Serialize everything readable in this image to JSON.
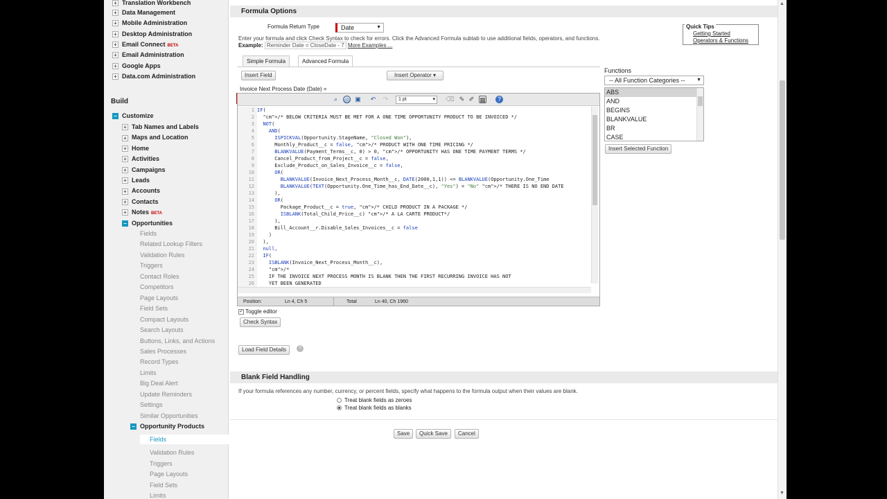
{
  "sidebar": {
    "admin_items": [
      "Translation Workbench",
      "Data Management",
      "Mobile Administration",
      "Desktop Administration",
      "Email Connect",
      "Email Administration",
      "Google Apps",
      "Data.com Administration"
    ],
    "beta_label": "BETA",
    "build_heading": "Build",
    "customize": "Customize",
    "customize_items": [
      "Tab Names and Labels",
      "Maps and Location",
      "Home",
      "Activities",
      "Campaigns",
      "Leads",
      "Accounts",
      "Contacts",
      "Notes",
      "Opportunities"
    ],
    "opportunity_items": [
      "Fields",
      "Related Lookup Filters",
      "Validation Rules",
      "Triggers",
      "Contact Roles",
      "Competitors",
      "Page Layouts",
      "Field Sets",
      "Compact Layouts",
      "Search Layouts",
      "Buttons, Links, and Actions",
      "Sales Processes",
      "Record Types",
      "Limits",
      "Big Deal Alert",
      "Update Reminders",
      "Settings",
      "Similar Opportunities",
      "Opportunity Products"
    ],
    "opp_product_items": [
      "Fields",
      "Validation Rules",
      "Triggers",
      "Page Layouts",
      "Field Sets",
      "Limits"
    ]
  },
  "formula_options": {
    "heading": "Formula Options",
    "return_type_label": "Formula Return Type",
    "return_type_value": "Date",
    "instructions": "Enter your formula and click Check Syntax to check for errors. Click the Advanced Formula subtab to use additional fields, operators, and functions.",
    "example_label": "Example:",
    "example_value": "Reminder Date = CloseDate - 7",
    "more_examples": "More Examples ..."
  },
  "quick_tips": {
    "title": "Quick Tips",
    "links": [
      "Getting Started",
      "Operators & Functions"
    ]
  },
  "tabs": [
    "Simple Formula",
    "Advanced Formula"
  ],
  "buttons": {
    "insert_field": "Insert Field",
    "insert_operator": "Insert Operator",
    "insert_function": "Insert Selected Function",
    "check_syntax": "Check Syntax",
    "load_field_details": "Load Field Details",
    "save": "Save",
    "quick_save": "Quick Save",
    "cancel": "Cancel"
  },
  "field_label": "Invoice Next Process Date (Date) =",
  "editor": {
    "font_size_value": "1 pt",
    "lines": [
      "IF(",
      "  /* BELOW CRITERIA MUST BE MET FOR A ONE TIME OPPORTUNITY PRODUCT TO BE INVOICED */",
      "  NOT(",
      "    AND(",
      "      ISPICKVAL(Opportunity.StageName, \"Closed Won\"),",
      "      Monthly_Product__c = false, /* PRODUCT WITH ONE TIME PRICING */",
      "      BLANKVALUE(Payment_Terms__c, 0) > 0, /* OPPORTUNITY HAS ONE TIME PAYMENT TERMS */",
      "      Cancel_Product_from_Project__c = false,",
      "      Exclude_Product_on_Sales_Invoice__c = false,",
      "      OR(",
      "        BLANKVALUE(Invoice_Next_Process_Month__c, DATE(2000,1,1)) <= BLANKVALUE(Opportunity.One_Time",
      "        BLANKVALUE(TEXT(Opportunity.One_Time_has_End_Date__c), \"Yes\") = \"No\" /* THERE IS NO END DATE",
      "      ),",
      "      OR(",
      "        Package_Product__c = true, /* CHILD PRODUCT IN A PACKAGE */",
      "        ISBLANK(Total_Child_Price__c) /* A LA CARTE PRODUCT*/",
      "      ),",
      "      Bill_Account__r.Disable_Sales_Invoices__c = false",
      "    )",
      "  ),",
      "  null,",
      "  IF(",
      "    ISBLANK(Invoice_Next_Process_Month__c),",
      "    /*",
      "    IF THE INVOICE NEXT PROCESS MONTH IS BLANK THEN THE FIRST RECURRING INVOICE HAS NOT",
      "    YET BEEN GENERATED"
    ],
    "status_position_label": "Position:",
    "status_position_value": "Ln 4, Ch 5",
    "status_total_label": "Total",
    "status_total_value": "Ln 40, Ch 1960",
    "toggle_editor": "Toggle editor"
  },
  "functions": {
    "label": "Functions",
    "category": "-- All Function Categories --",
    "items": [
      "ABS",
      "AND",
      "BEGINS",
      "BLANKVALUE",
      "BR",
      "CASE"
    ]
  },
  "blank_handling": {
    "heading": "Blank Field Handling",
    "description": "If your formula references any number, currency, or percent fields, specify what happens to the formula output when their values are blank.",
    "option_zeroes": "Treat blank fields as zeroes",
    "option_blanks": "Treat blank fields as blanks",
    "selected": "blanks"
  }
}
